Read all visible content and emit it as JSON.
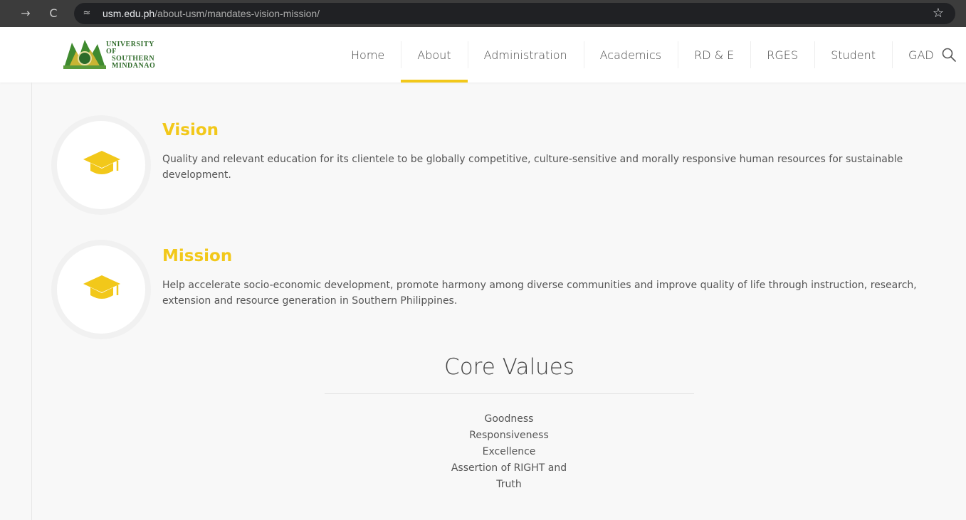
{
  "browser": {
    "back_icon": "→",
    "reload_icon": "C",
    "site_info_icon": "≈",
    "url_host": "usm.edu.ph",
    "url_path": "/about-usm/mandates-vision-mission/",
    "bookmark_icon": "☆"
  },
  "header": {
    "logo_text": [
      "UNIVERSITY OF",
      "SOUTHERN",
      "MINDANAO"
    ],
    "nav": [
      {
        "label": "Home"
      },
      {
        "label": "About",
        "active": true
      },
      {
        "label": "Administration"
      },
      {
        "label": "Academics"
      },
      {
        "label": "RD & E"
      },
      {
        "label": "RGES"
      },
      {
        "label": "Student"
      },
      {
        "label": "GAD"
      }
    ]
  },
  "vision": {
    "title": "Vision",
    "icon": "graduation-cap-icon",
    "text": "Quality and relevant education for its clientele to be globally competitive, culture-sensitive and morally responsive human resources for sustainable development."
  },
  "mission": {
    "title": "Mission",
    "icon": "graduation-cap-icon",
    "text": "Help accelerate socio-economic development, promote harmony among diverse communities and improve quality of life through instruction, research, extension and resource generation in Southern Philippines."
  },
  "core_values": {
    "title": "Core Values",
    "items": [
      "Goodness",
      "Responsiveness",
      "Excellence",
      "Assertion of RIGHT and",
      "Truth"
    ]
  },
  "colors": {
    "accent": "#f2c81a",
    "chrome": "#3c3c3c"
  }
}
